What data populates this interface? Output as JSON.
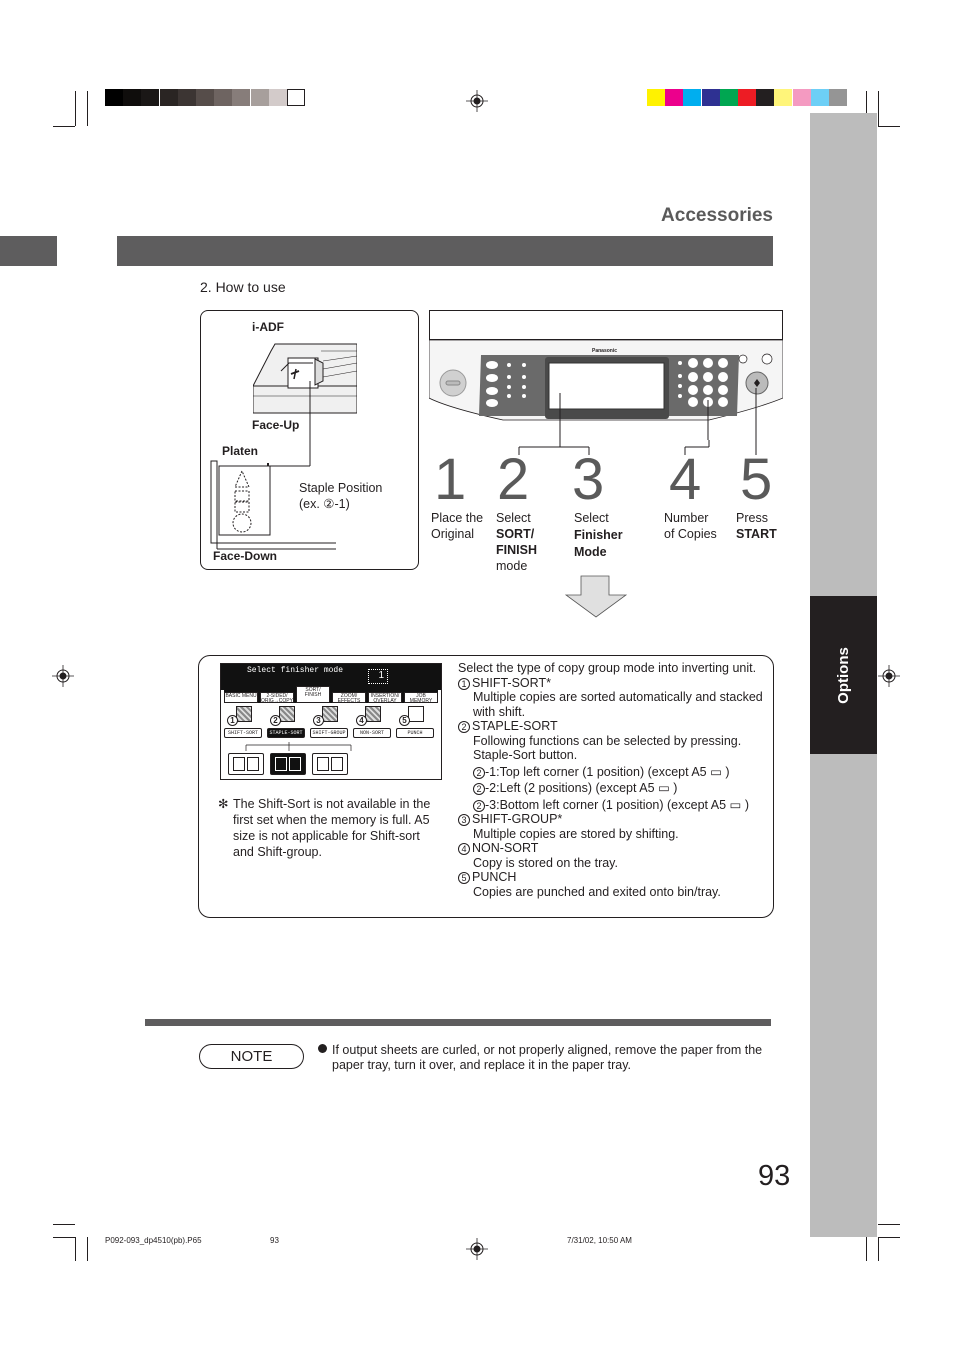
{
  "print_marks": {
    "grayscale_swatches": [
      "#000000",
      "#0f0d0c",
      "#1a1716",
      "#2a2523",
      "#3c3533",
      "#564d4a",
      "#6e6461",
      "#877d7a",
      "#a79f9c",
      "#d3cbca",
      "#ffffff"
    ],
    "color_swatches": [
      "#fff200",
      "#ec008c",
      "#00aeef",
      "#2e3192",
      "#00a651",
      "#ed1c24",
      "#231f20",
      "#fff57a",
      "#f49ac1",
      "#6dcff6",
      "#959595"
    ]
  },
  "header": {
    "title": "Accessories"
  },
  "side_tab": {
    "label": "Options"
  },
  "section": {
    "title": "2. How to use"
  },
  "originals_diagram": {
    "iadf_label": "i-ADF",
    "face_up_label": "Face-Up",
    "platen_label": "Platen",
    "staple_position_label": "Staple Position",
    "staple_example": "(ex. ②-1)",
    "face_down_label": "Face-Down"
  },
  "control_panel": {
    "brand": "Panasonic"
  },
  "steps": [
    {
      "number": "1",
      "line1": "Place the",
      "line2": "Original",
      "bold": "",
      "line3": ""
    },
    {
      "number": "2",
      "line1": "Select",
      "bold": "SORT/ FINISH",
      "line3": "mode"
    },
    {
      "number": "3",
      "line1": "Select",
      "bold": "Finisher Mode",
      "line3": ""
    },
    {
      "number": "4",
      "line1": "Number",
      "line2": "of Copies",
      "bold": "",
      "line3": ""
    },
    {
      "number": "5",
      "line1": "Press",
      "bold": "START",
      "line3": ""
    }
  ],
  "screen": {
    "title": "Select finisher mode",
    "copy_count": "1",
    "tabs": [
      "BASIC MENU",
      "2-SIDED/ ORIG→COPY",
      "SORT/ FINISH",
      "ZOOM/ EFFECTS",
      "INSERTION/ OVERLAY",
      "JOB MEMORY"
    ],
    "active_tab": "SORT/ FINISH",
    "modes": [
      {
        "num": "1",
        "label": "SHIFT-SORT"
      },
      {
        "num": "2",
        "label": "STAPLE-SORT"
      },
      {
        "num": "3",
        "label": "SHIFT-GROUP"
      },
      {
        "num": "4",
        "label": "NON-SORT"
      },
      {
        "num": "5",
        "label": "PUNCH"
      }
    ],
    "active_mode": "STAPLE-SORT",
    "staple_options": [
      "top-left-corner",
      "left-2-positions",
      "bottom-left-corner"
    ]
  },
  "description": {
    "intro": "Select the type of copy group mode into inverting unit.",
    "items": [
      {
        "num": "1",
        "title": "SHIFT-SORT*",
        "text": "Multiple copies are sorted automatically and stacked with shift."
      },
      {
        "num": "2",
        "title": "STAPLE-SORT",
        "text": "Following functions can be selected by pressing. Staple-Sort button.",
        "sub": [
          "-1:Top left corner (1 position) (except A5 ▭ )",
          "-2:Left (2 positions) (except A5 ▭ )",
          "-3:Bottom left corner (1 position) (except A5 ▭ )"
        ]
      },
      {
        "num": "3",
        "title": "SHIFT-GROUP*",
        "text": "Multiple copies are stored by shifting."
      },
      {
        "num": "4",
        "title": "NON-SORT",
        "text": "Copy is stored on the tray."
      },
      {
        "num": "5",
        "title": "PUNCH",
        "text": "Copies are punched and exited onto bin/tray."
      }
    ]
  },
  "footnote": {
    "marker": "✻",
    "text": "The Shift-Sort is not available in the first set when the memory is full. A5 size is not applicable for Shift-sort and Shift-group."
  },
  "note": {
    "label": "NOTE",
    "text": "If output sheets are curled, or not properly aligned, remove the paper from the paper tray, turn it over, and replace it in the paper tray."
  },
  "page_number": "93",
  "slug": {
    "file": "P092-093_dp4510(pb).P65",
    "page": "93",
    "date": "7/31/02, 10:50 AM"
  }
}
